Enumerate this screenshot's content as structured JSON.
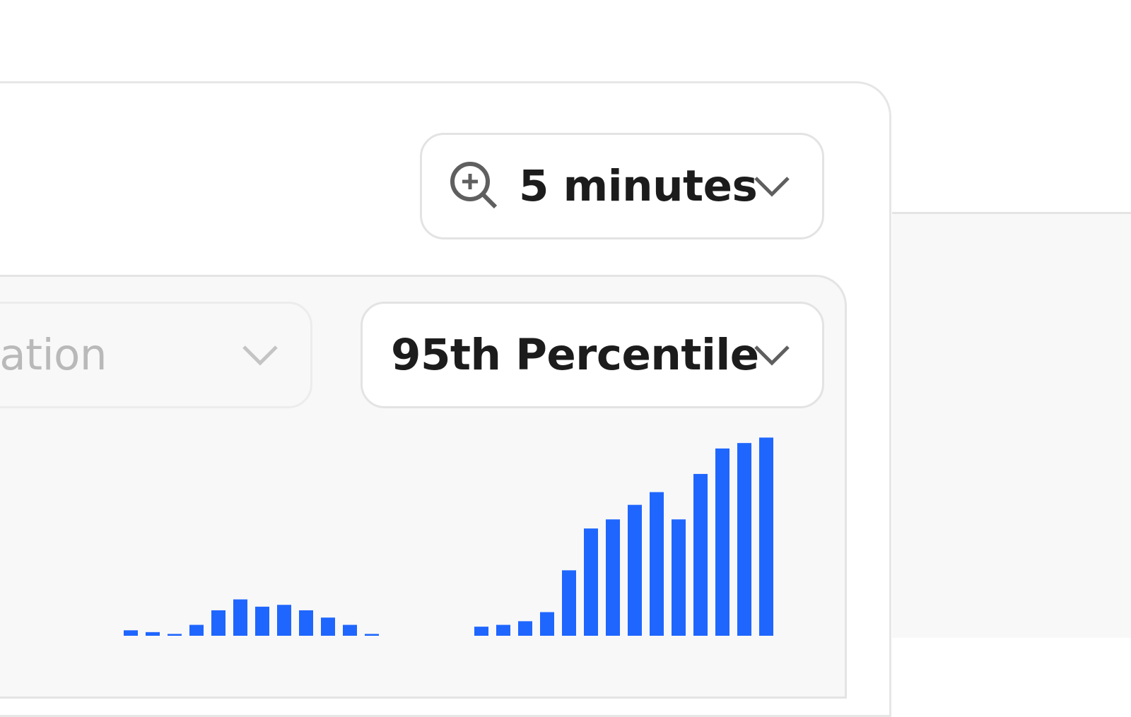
{
  "time_range": {
    "label": "5 minutes",
    "icon": "zoom-in-icon"
  },
  "metric": {
    "label": "95th Percentile"
  },
  "grouping": {
    "label": "ation"
  },
  "colors": {
    "bar": "#1f66ff",
    "chevron": "#5f5f5f",
    "chevron_faded": "#c4c4c4"
  },
  "chart_data": {
    "type": "bar",
    "values": [
      3,
      2,
      1,
      6,
      14,
      20,
      16,
      17,
      14,
      10,
      6,
      1,
      0,
      0,
      0,
      0,
      5,
      6,
      8,
      13,
      36,
      59,
      64,
      72,
      79,
      64,
      89,
      103,
      106,
      109
    ],
    "ylim": [
      0,
      115
    ],
    "grid": false,
    "legend": "none"
  }
}
